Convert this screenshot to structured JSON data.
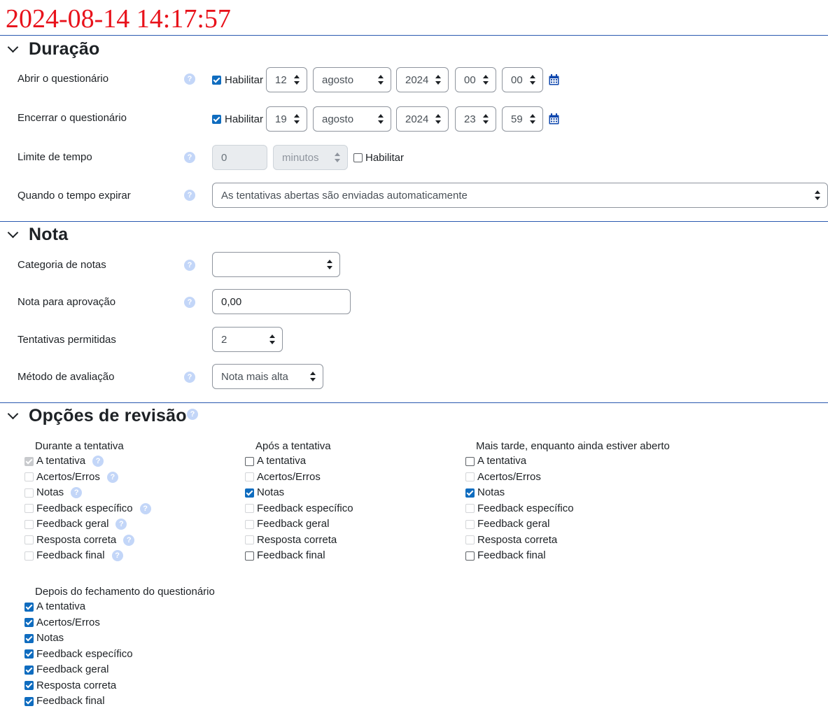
{
  "timestamp": "2024-08-14 14:17:57",
  "help_glyph": "?",
  "duracao": {
    "title": "Duração",
    "abrir": {
      "label": "Abrir o questionário",
      "habilitar": "Habilitar",
      "checked": true,
      "day": "12",
      "month": "agosto",
      "year": "2024",
      "hour": "00",
      "minute": "00"
    },
    "encerrar": {
      "label": "Encerrar o questionário",
      "habilitar": "Habilitar",
      "checked": true,
      "day": "19",
      "month": "agosto",
      "year": "2024",
      "hour": "23",
      "minute": "59"
    },
    "limite": {
      "label": "Limite de tempo",
      "value": "0",
      "unit": "minutos",
      "habilitar": "Habilitar",
      "checked": false
    },
    "expirar": {
      "label": "Quando o tempo expirar",
      "value": "As tentativas abertas são enviadas automaticamente"
    }
  },
  "nota": {
    "title": "Nota",
    "categoria": {
      "label": "Categoria de notas",
      "value": ""
    },
    "aprovacao": {
      "label": "Nota para aprovação",
      "value": "0,00"
    },
    "tentativas": {
      "label": "Tentativas permitidas",
      "value": "2"
    },
    "metodo": {
      "label": "Método de avaliação",
      "value": "Nota mais alta"
    }
  },
  "revisao": {
    "title": "Opções de revisão",
    "item_labels": [
      "A tentativa",
      "Acertos/Erros",
      "Notas",
      "Feedback específico",
      "Feedback geral",
      "Resposta correta",
      "Feedback final"
    ],
    "durante": {
      "title": "Durante a tentativa",
      "states": [
        "disabled-checked",
        "disabled",
        "disabled",
        "disabled",
        "disabled",
        "disabled",
        "disabled"
      ]
    },
    "apos": {
      "title": "Após a tentativa",
      "states": [
        "unchecked",
        "disabled",
        "checked",
        "disabled",
        "disabled",
        "disabled",
        "unchecked"
      ]
    },
    "mais_tarde": {
      "title": "Mais tarde, enquanto ainda estiver aberto",
      "states": [
        "unchecked",
        "disabled",
        "checked",
        "disabled",
        "disabled",
        "disabled",
        "unchecked"
      ]
    },
    "depois": {
      "title": "Depois do fechamento do questionário",
      "states": [
        "checked",
        "checked",
        "checked",
        "checked",
        "checked",
        "checked",
        "checked"
      ]
    }
  },
  "colors": {
    "timestamp": "#e8121b",
    "divider": "#2a5ab0",
    "checkbox_checked": "#0f6cbf",
    "help_icon": "#c3d6f8",
    "calendar_icon": "#0f47ad"
  }
}
